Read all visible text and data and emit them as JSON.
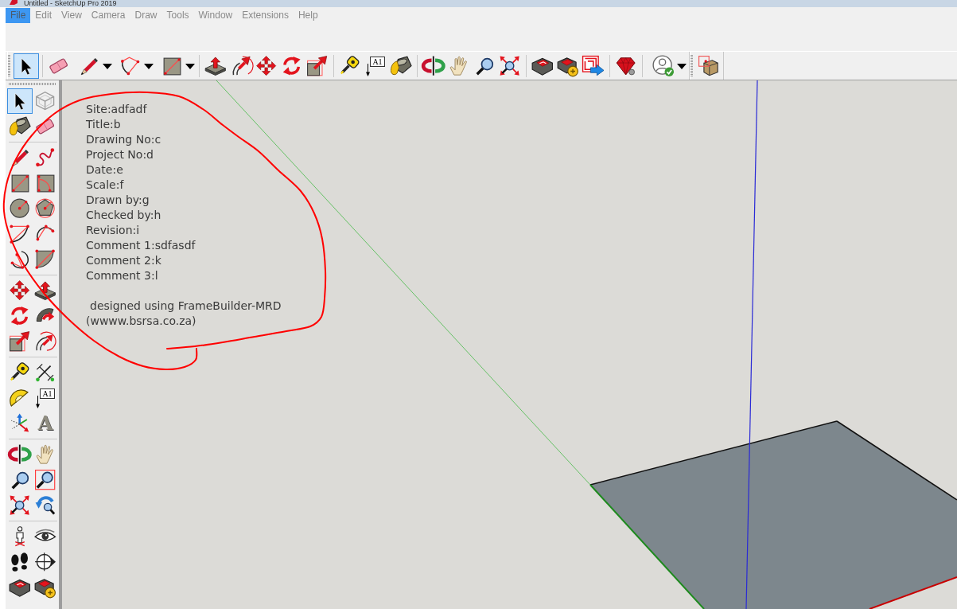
{
  "window": {
    "title": "Untitled - SketchUp Pro 2019"
  },
  "menu": [
    {
      "label": "File",
      "selected": true
    },
    {
      "label": "Edit",
      "selected": false
    },
    {
      "label": "View",
      "selected": false
    },
    {
      "label": "Camera",
      "selected": false
    },
    {
      "label": "Draw",
      "selected": false
    },
    {
      "label": "Tools",
      "selected": false
    },
    {
      "label": "Window",
      "selected": false
    },
    {
      "label": "Extensions",
      "selected": false
    },
    {
      "label": "Help",
      "selected": false
    }
  ],
  "toolbars": [
    {
      "groups": [
        {
          "buttons": [
            {
              "selected": true,
              "dropdown": false
            }
          ]
        },
        {
          "buttons": [
            {
              "selected": false,
              "dropdown": false
            },
            {
              "selected": false,
              "dropdown": true
            },
            {
              "selected": false,
              "dropdown": true
            },
            {
              "selected": false,
              "dropdown": true
            }
          ]
        },
        {
          "buttons": [
            {
              "selected": false,
              "dropdown": false
            },
            {
              "selected": false,
              "dropdown": false
            },
            {
              "selected": false,
              "dropdown": false
            },
            {
              "selected": false,
              "dropdown": false
            },
            {
              "selected": false,
              "dropdown": false
            }
          ]
        },
        {
          "buttons": [
            {
              "selected": false,
              "dropdown": false
            },
            {
              "selected": false,
              "dropdown": false,
              "label": "A1"
            },
            {
              "selected": false,
              "dropdown": false
            }
          ]
        },
        {
          "buttons": [
            {
              "selected": false,
              "dropdown": false
            },
            {
              "selected": false,
              "dropdown": false
            },
            {
              "selected": false,
              "dropdown": false
            },
            {
              "selected": false,
              "dropdown": false
            }
          ]
        },
        {
          "buttons": [
            {
              "selected": false,
              "dropdown": false
            },
            {
              "selected": false,
              "dropdown": false
            },
            {
              "selected": false,
              "dropdown": false
            }
          ]
        },
        {
          "buttons": [
            {
              "selected": false,
              "dropdown": false
            }
          ]
        },
        {
          "buttons": [
            {
              "selected": false,
              "dropdown": true
            }
          ]
        }
      ]
    },
    {
      "groups": [
        {
          "buttons": [
            {
              "selected": false,
              "dropdown": false
            }
          ]
        }
      ]
    }
  ],
  "tool_palette": {
    "groups": [
      {
        "buttons": [
          {
            "selected": true
          },
          {
            "selected": false
          },
          {
            "selected": false
          },
          {
            "selected": false
          }
        ]
      },
      {
        "buttons": [
          {
            "selected": false
          },
          {
            "selected": false
          },
          {
            "selected": false
          },
          {
            "selected": false
          },
          {
            "selected": false
          },
          {
            "selected": false
          },
          {
            "selected": false
          },
          {
            "selected": false
          },
          {
            "selected": false
          },
          {
            "selected": false
          }
        ]
      },
      {
        "buttons": [
          {
            "selected": false
          },
          {
            "selected": false
          },
          {
            "selected": false
          },
          {
            "selected": false
          },
          {
            "selected": false
          },
          {
            "selected": false
          }
        ]
      },
      {
        "buttons": [
          {
            "selected": false
          },
          {
            "selected": false
          },
          {
            "selected": false
          },
          {
            "selected": false,
            "label": "A1"
          },
          {
            "selected": false
          },
          {
            "selected": false,
            "label": "A"
          }
        ]
      },
      {
        "buttons": [
          {
            "selected": false
          },
          {
            "selected": false
          },
          {
            "selected": false
          },
          {
            "selected": false
          },
          {
            "selected": false
          },
          {
            "selected": false
          }
        ]
      },
      {
        "buttons": [
          {
            "selected": false
          },
          {
            "selected": false
          },
          {
            "selected": false
          },
          {
            "selected": false
          },
          {
            "selected": false
          },
          {
            "selected": false
          }
        ]
      }
    ]
  },
  "note": {
    "lines": [
      "Site:adfadf",
      "Title:b",
      "Drawing No:c",
      "Project No:d",
      "Date:e",
      "Scale:f",
      "Drawn by:g",
      "Checked by:h",
      "Revision:i",
      "Comment 1:sdfasdf",
      "Comment 2:k",
      "Comment 3:l"
    ],
    "credit": [
      "designed using FrameBuilder-MRD",
      "(wwww.bsrsa.co.za)"
    ]
  }
}
